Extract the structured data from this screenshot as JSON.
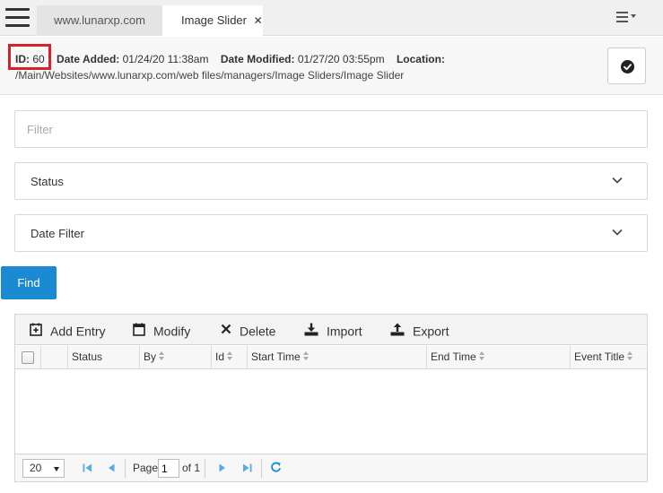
{
  "header": {
    "tabs": [
      {
        "label": "www.lunarxp.com"
      },
      {
        "label": "Image Slider"
      }
    ],
    "close_glyph": "✕"
  },
  "info": {
    "id_label": "ID:",
    "id_value": "60",
    "date_added_label": "Date Added:",
    "date_added_value": "01/24/20 11:38am",
    "date_modified_label": "Date Modified:",
    "date_modified_value": "01/27/20 03:55pm",
    "location_label": "Location:",
    "location_path": "/Main/Websites/www.lunarxp.com/web files/managers/Image Sliders/Image Slider"
  },
  "filters": {
    "filter_placeholder": "Filter",
    "status_label": "Status",
    "date_filter_label": "Date Filter",
    "find_label": "Find"
  },
  "toolbar": {
    "add_label": "Add Entry",
    "modify_label": "Modify",
    "delete_label": "Delete",
    "import_label": "Import",
    "export_label": "Export"
  },
  "table": {
    "columns": [
      "Status",
      "By",
      "Id",
      "Start Time",
      "End Time",
      "Event Title"
    ],
    "rows": []
  },
  "pager": {
    "per_page": "20",
    "page_label": "Page",
    "page_value": "1",
    "of_label": "of 1"
  },
  "colors": {
    "accent": "#1a8bd0",
    "highlight": "#d6202a",
    "pager_icon": "#5aa9e0"
  },
  "icons": [
    "hamburger-icon",
    "menu-icon",
    "check-circle-icon",
    "chevron-down-icon",
    "add-icon",
    "calendar-icon",
    "close-icon",
    "download-icon",
    "upload-icon",
    "first-page-icon",
    "prev-page-icon",
    "next-page-icon",
    "last-page-icon",
    "refresh-icon"
  ]
}
